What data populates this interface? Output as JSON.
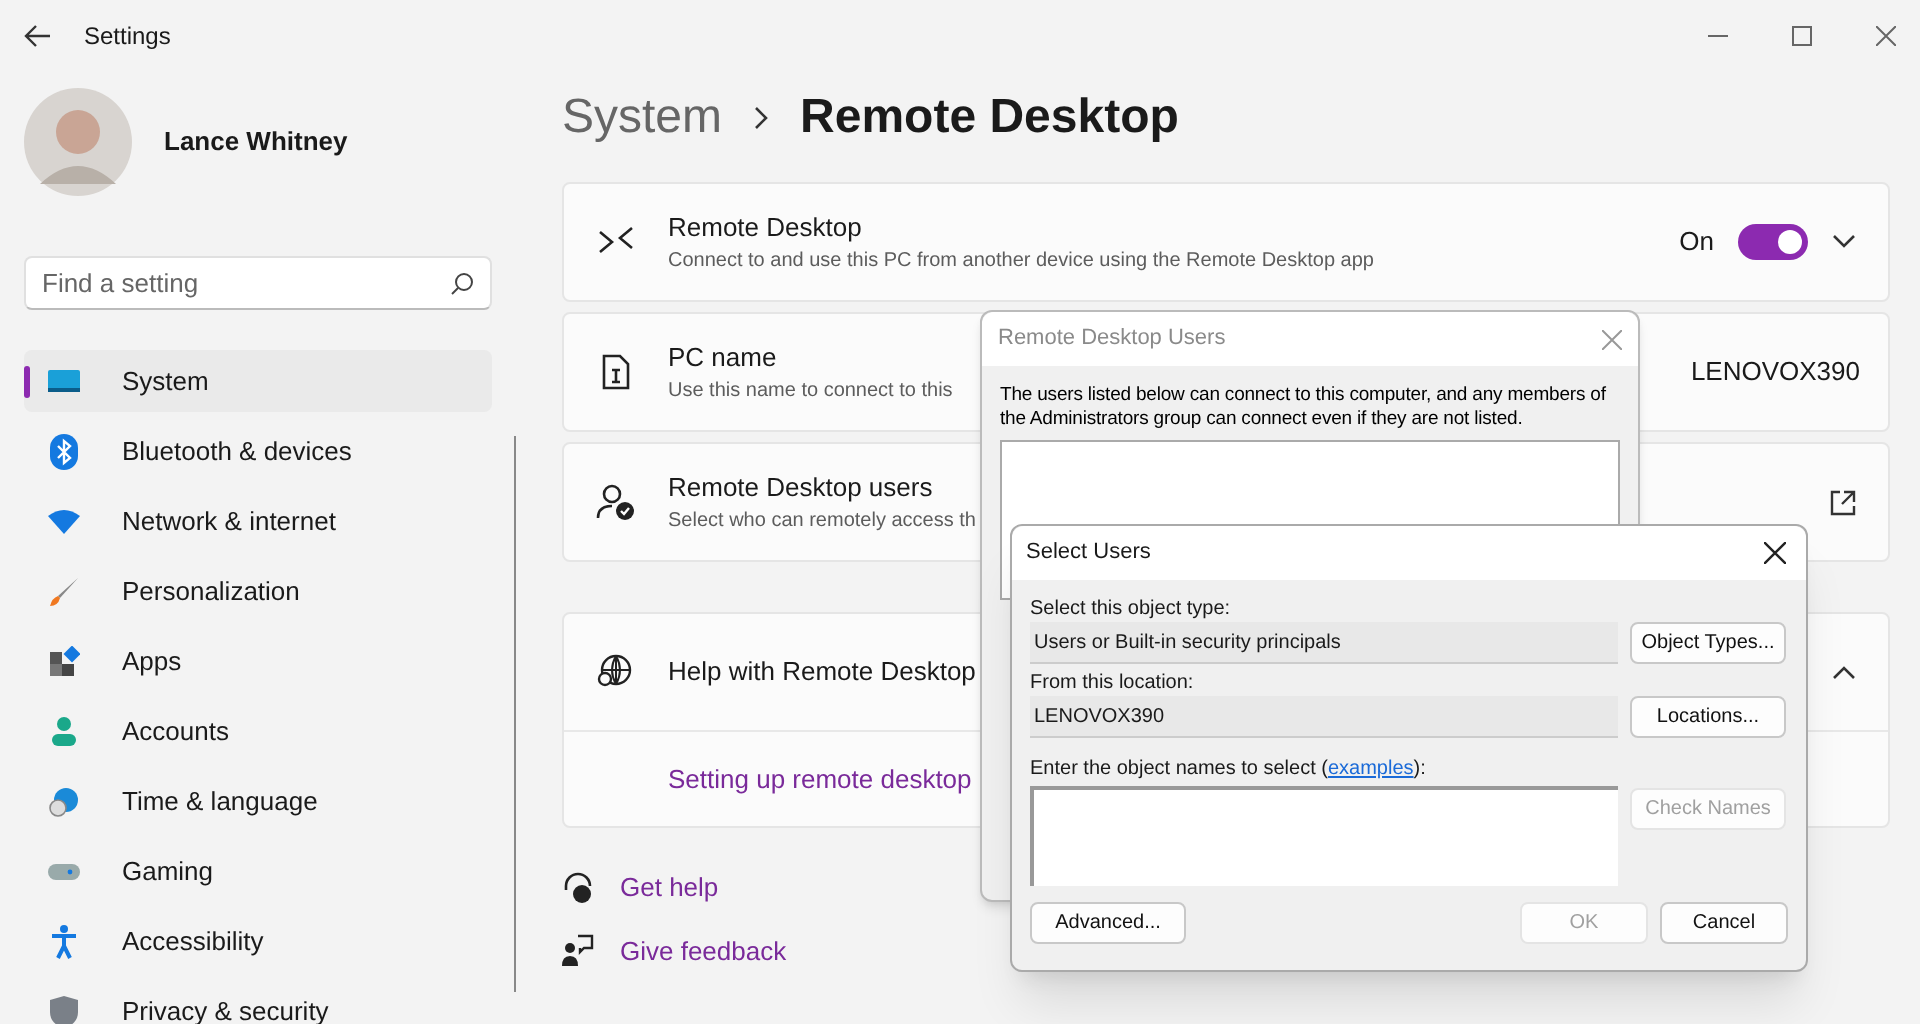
{
  "window": {
    "title": "Settings"
  },
  "user": {
    "name": "Lance Whitney"
  },
  "search": {
    "placeholder": "Find a setting"
  },
  "sidebar": {
    "items": [
      {
        "label": "System",
        "selected": true
      },
      {
        "label": "Bluetooth & devices",
        "selected": false
      },
      {
        "label": "Network & internet",
        "selected": false
      },
      {
        "label": "Personalization",
        "selected": false
      },
      {
        "label": "Apps",
        "selected": false
      },
      {
        "label": "Accounts",
        "selected": false
      },
      {
        "label": "Time & language",
        "selected": false
      },
      {
        "label": "Gaming",
        "selected": false
      },
      {
        "label": "Accessibility",
        "selected": false
      },
      {
        "label": "Privacy & security",
        "selected": false
      }
    ]
  },
  "breadcrumb": [
    "System",
    "Remote Desktop"
  ],
  "cards": [
    {
      "kind": "toggle",
      "title": "Remote Desktop",
      "subtitle": "Connect to and use this PC from another device using the Remote Desktop app",
      "state_label": "On",
      "on": true,
      "expanded": false
    },
    {
      "kind": "value",
      "title": "PC name",
      "subtitle": "Use this name to connect to this",
      "value": "LENOVOX390"
    },
    {
      "kind": "link",
      "title": "Remote Desktop users",
      "subtitle": "Select who can remotely access th"
    }
  ],
  "help": {
    "title": "Help with Remote Desktop",
    "expanded": true,
    "link": "Setting up remote desktop"
  },
  "footer_links": [
    {
      "label": "Get help"
    },
    {
      "label": "Give feedback"
    }
  ],
  "rdu_dialog": {
    "title": "Remote Desktop Users",
    "description": "The users listed below can connect to this computer, and any members of the Administrators group can connect even if they are not listed."
  },
  "select_dialog": {
    "title": "Select Users",
    "object_type_label": "Select this object type:",
    "object_type": "Users or Built-in security principals",
    "object_types_button": "Object Types...",
    "location_label": "From this location:",
    "location": "LENOVOX390",
    "locations_button": "Locations...",
    "names_label_before": "Enter the object names to select (",
    "names_link": "examples",
    "names_label_after": "):",
    "check_names_button": {
      "label": "Check Names",
      "disabled": true
    },
    "advanced_button": "Advanced...",
    "ok_button": {
      "label": "OK",
      "disabled": true
    },
    "cancel_button": "Cancel"
  }
}
